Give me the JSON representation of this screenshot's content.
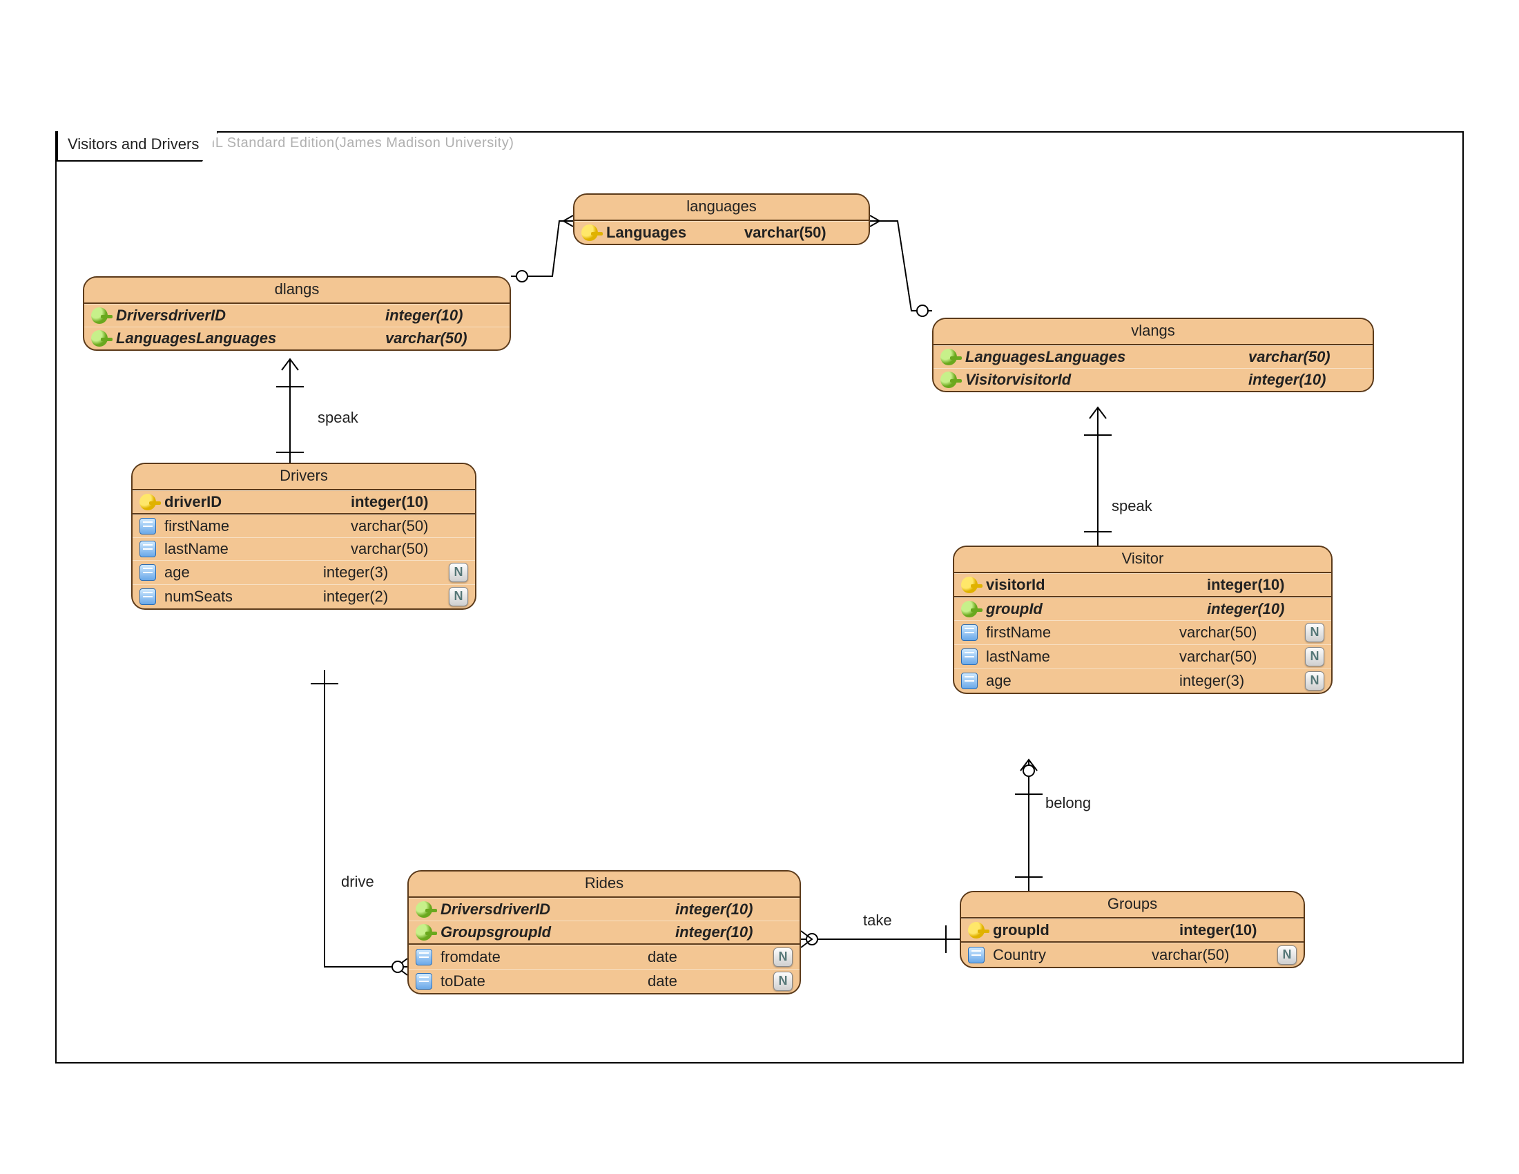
{
  "watermark": "Visual Paradigm for UML Standard Edition(James Madison University)",
  "frameTitle": "Visitors and Drivers",
  "nullableBadge": "N",
  "entities": {
    "languages": {
      "title": "languages",
      "rows": [
        {
          "kind": "pk",
          "name": "Languages",
          "type": "varchar(50)"
        }
      ]
    },
    "dlangs": {
      "title": "dlangs",
      "rows": [
        {
          "kind": "fk",
          "name": "DriversdriverID",
          "type": "integer(10)"
        },
        {
          "kind": "fk",
          "name": "LanguagesLanguages",
          "type": "varchar(50)"
        }
      ]
    },
    "vlangs": {
      "title": "vlangs",
      "rows": [
        {
          "kind": "fk",
          "name": "LanguagesLanguages",
          "type": "varchar(50)"
        },
        {
          "kind": "fk",
          "name": "VisitorvisitorId",
          "type": "integer(10)"
        }
      ]
    },
    "drivers": {
      "title": "Drivers",
      "pkRows": [
        {
          "kind": "pk",
          "name": "driverID",
          "type": "integer(10)"
        }
      ],
      "rows": [
        {
          "kind": "col",
          "name": "firstName",
          "type": "varchar(50)"
        },
        {
          "kind": "col",
          "name": "lastName",
          "type": "varchar(50)"
        },
        {
          "kind": "col",
          "name": "age",
          "type": "integer(3)",
          "nullable": true
        },
        {
          "kind": "col",
          "name": "numSeats",
          "type": "integer(2)",
          "nullable": true
        }
      ]
    },
    "visitor": {
      "title": "Visitor",
      "pkRows": [
        {
          "kind": "pk",
          "name": "visitorId",
          "type": "integer(10)"
        }
      ],
      "rows": [
        {
          "kind": "fk",
          "name": "groupId",
          "type": "integer(10)"
        },
        {
          "kind": "col",
          "name": "firstName",
          "type": "varchar(50)",
          "nullable": true
        },
        {
          "kind": "col",
          "name": "lastName",
          "type": "varchar(50)",
          "nullable": true
        },
        {
          "kind": "col",
          "name": "age",
          "type": "integer(3)",
          "nullable": true
        }
      ]
    },
    "rides": {
      "title": "Rides",
      "rows": [
        {
          "kind": "fk",
          "name": "DriversdriverID",
          "type": "integer(10)"
        },
        {
          "kind": "fk",
          "name": "GroupsgroupId",
          "type": "integer(10)"
        },
        {
          "kind": "col",
          "name": "fromdate",
          "type": "date",
          "nullable": true
        },
        {
          "kind": "col",
          "name": "toDate",
          "type": "date",
          "nullable": true
        }
      ]
    },
    "groups": {
      "title": "Groups",
      "pkRows": [
        {
          "kind": "pk",
          "name": "groupId",
          "type": "integer(10)"
        }
      ],
      "rows": [
        {
          "kind": "col",
          "name": "Country",
          "type": "varchar(50)",
          "nullable": true
        }
      ]
    }
  },
  "relations": {
    "speak1": "speak",
    "speak2": "speak",
    "drive": "drive",
    "take": "take",
    "belong": "belong"
  }
}
